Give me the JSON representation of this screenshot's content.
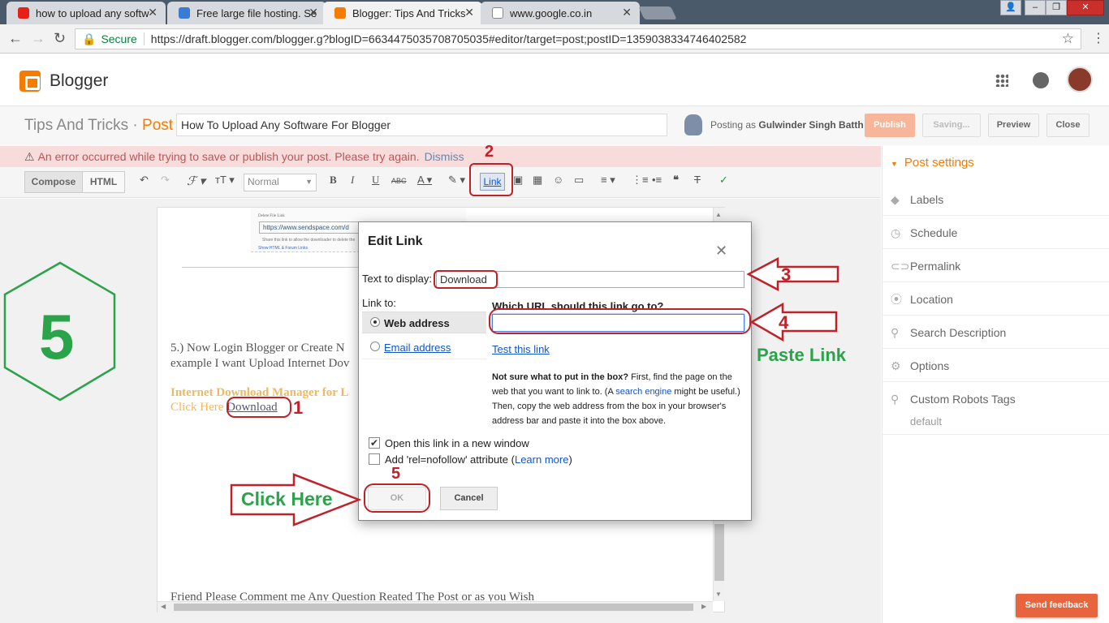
{
  "browser": {
    "tabs": [
      {
        "title": "how to upload any softw"
      },
      {
        "title": "Free large file hosting. Se"
      },
      {
        "title": "Blogger: Tips And Tricks"
      },
      {
        "title": "www.google.co.in"
      }
    ],
    "secure_label": "Secure",
    "url": "https://draft.blogger.com/blogger.g?blogID=6634475035708705035#editor/target=post;postID=1359038334746402582"
  },
  "header": {
    "brand": "Blogger"
  },
  "postbar": {
    "blog_title": "Tips And Tricks",
    "sep": " · ",
    "post_label": "Post",
    "post_title": "How To Upload Any Software For Blogger",
    "posting_as": "Posting as",
    "author": "Gulwinder Singh Batth",
    "publish": "Publish",
    "saving": "Saving...",
    "preview": "Preview",
    "close": "Close"
  },
  "error": {
    "message": "An error occurred while trying to save or publish your post. Please try again.",
    "dismiss": "Dismiss"
  },
  "toolbar": {
    "compose": "Compose",
    "html": "HTML",
    "format": "Normal",
    "link": "Link"
  },
  "editor": {
    "sub_link_label": "Delete File Link",
    "sub_url": "https://www.sendspace.com/d",
    "sub_desc": "Share this link to allow the downloader to delete the",
    "sub_html": "Show HTML & Forum Links",
    "line1": "5.)  Now Login Blogger or Create N",
    "line2": "example I want Upload Internet Dov",
    "idm": "Internet Download Manager for L",
    "click_here": "Click Here ",
    "download_link": "Download",
    "footer_line": "Friend Please Comment me Any Question Reated The Post or as you Wish"
  },
  "sidebar": {
    "title": "Post settings",
    "items": [
      {
        "label": "Labels"
      },
      {
        "label": "Schedule"
      },
      {
        "label": "Permalink"
      },
      {
        "label": "Location"
      },
      {
        "label": "Search Description"
      },
      {
        "label": "Options"
      },
      {
        "label": "Custom Robots Tags"
      }
    ],
    "robots_value": "default"
  },
  "dialog": {
    "title": "Edit Link",
    "text_to_display_label": "Text to display:",
    "text_to_display_value": "Download",
    "link_to": "Link to:",
    "web_address": "Web address",
    "email_address": "Email address",
    "url_question": "Which URL should this link go to?",
    "url_value": "",
    "test_link": "Test this link",
    "help_bold": "Not sure what to put in the box?",
    "help_1": " First, find the page on the web that you want to link to. (A ",
    "help_link": "search engine",
    "help_2": " might be useful.) Then, copy the web address from the box in your browser's address bar and paste it into the box above.",
    "new_window": "Open this link in a new window",
    "nofollow": "Add 'rel=nofollow' attribute (",
    "learn_more": "Learn more",
    "nofollow_end": ")",
    "ok": "OK",
    "cancel": "Cancel"
  },
  "annotations": {
    "step_big": "5",
    "n1": "1",
    "n2": "2",
    "n3": "3",
    "n4": "4",
    "n5": "5",
    "paste_link": "Paste Link",
    "click_here": "Click Here"
  },
  "feedback": "Send feedback",
  "colors": {
    "accent": "#f57c00",
    "annotation_red": "#c0222a",
    "annotation_green": "#2aa34a"
  }
}
